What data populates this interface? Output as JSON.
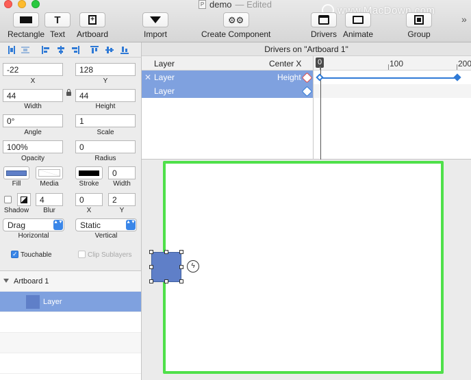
{
  "window": {
    "title": "demo",
    "edited": "— Edited",
    "doc_icon": "P",
    "watermark": "www.MacDown.com"
  },
  "toolbar": {
    "rectangle": "Rectangle",
    "text": "Text",
    "text_glyph": "T",
    "artboard": "Artboard",
    "artboard_glyph": "+",
    "import": "Import",
    "create_component": "Create Component",
    "create_component_glyph": "⚙⚙",
    "drivers": "Drivers",
    "animate": "Animate",
    "group": "Group",
    "overflow": "»"
  },
  "inspector": {
    "x": {
      "value": "-22",
      "label": "X"
    },
    "y": {
      "value": "128",
      "label": "Y"
    },
    "width": {
      "value": "44",
      "label": "Width"
    },
    "height": {
      "value": "44",
      "label": "Height"
    },
    "angle": {
      "value": "0°",
      "label": "Angle"
    },
    "scale": {
      "value": "1",
      "label": "Scale"
    },
    "opacity": {
      "value": "100%",
      "label": "Opacity"
    },
    "radius": {
      "value": "0",
      "label": "Radius"
    },
    "fill_label": "Fill",
    "media_label": "Media",
    "stroke_label": "Stroke",
    "stroke_width": {
      "value": "0",
      "label": "Width"
    },
    "shadow_label": "Shadow",
    "blur": {
      "value": "4",
      "label": "Blur"
    },
    "shadow_x": {
      "value": "0",
      "label": "X"
    },
    "shadow_y": {
      "value": "2",
      "label": "Y"
    },
    "horizontal": {
      "value": "Drag",
      "label": "Horizontal"
    },
    "vertical": {
      "value": "Static",
      "label": "Vertical"
    },
    "touchable": "Touchable",
    "clip_sublayers": "Clip Sublayers",
    "stepper_glyph": "▲▼",
    "fill_color": "#5f7fc8"
  },
  "layers": {
    "artboard": "Artboard 1",
    "layer": "Layer"
  },
  "drivers": {
    "header": "Drivers on \"Artboard 1\"",
    "col_layer": "Layer",
    "col_property": "Center X",
    "rows": [
      {
        "close": "✕",
        "layer": "Layer",
        "property": "Height"
      },
      {
        "layer": "Layer",
        "property": ""
      }
    ],
    "timeline": {
      "playhead": "0",
      "ticks": [
        "100",
        "200"
      ]
    }
  },
  "canvas": {
    "bolt_glyph": "ϟ",
    "artboard_color": "#4fe04a"
  }
}
